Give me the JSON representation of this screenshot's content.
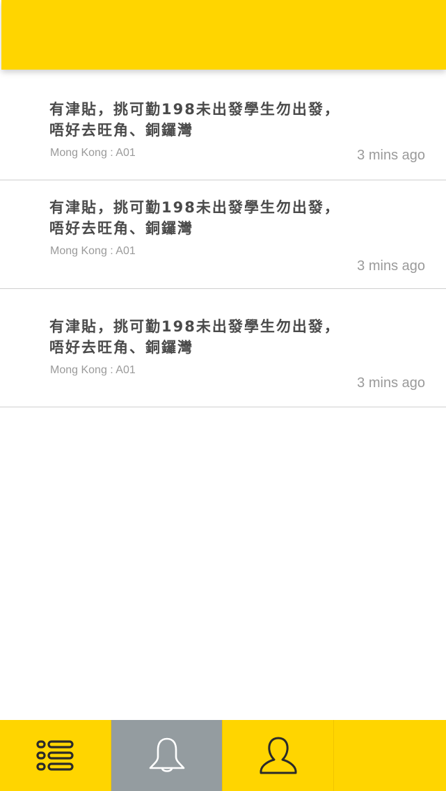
{
  "notifications": [
    {
      "title_line1": "有津貼，挑可勤198未出發學生勿出發，",
      "title_line2": "唔好去旺角、銅鑼灣",
      "location": "Mong Kong : A01",
      "time": "3 mins ago"
    },
    {
      "title_line1": "有津貼，挑可勤198未出發學生勿出發，",
      "title_line2": "唔好去旺角、銅鑼灣",
      "location": "Mong Kong : A01",
      "time": "3 mins ago"
    },
    {
      "title_line1": "有津貼，挑可勤198未出發學生勿出發，",
      "title_line2": "唔好去旺角、銅鑼灣",
      "location": "Mong Kong : A01",
      "time": "3 mins ago"
    }
  ],
  "tabbar": {
    "tabs": [
      {
        "icon": "list-icon",
        "active": false
      },
      {
        "icon": "bell-icon",
        "active": true
      },
      {
        "icon": "user-icon",
        "active": false
      },
      {
        "icon": "",
        "active": false
      }
    ]
  },
  "colors": {
    "accent": "#FFD500",
    "active_tab": "#949CA0",
    "title_text": "#4A4A4A",
    "meta_text": "#9A9A9A"
  }
}
